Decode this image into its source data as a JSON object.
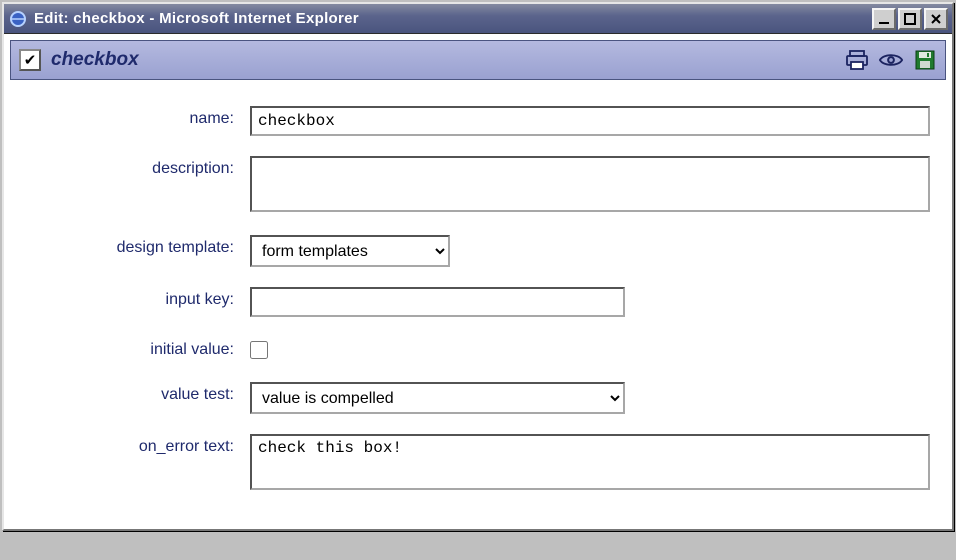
{
  "window": {
    "title": "Edit: checkbox - Microsoft Internet Explorer"
  },
  "header": {
    "heading": "checkbox"
  },
  "form": {
    "name": {
      "label": "name:",
      "value": "checkbox"
    },
    "description": {
      "label": "description:",
      "value": ""
    },
    "design": {
      "label": "design template:",
      "value": "form templates"
    },
    "inputkey": {
      "label": "input key:",
      "value": ""
    },
    "initial": {
      "label": "initial value:",
      "checked": false
    },
    "valuetest": {
      "label": "value test:",
      "value": "value is compelled"
    },
    "onerror": {
      "label": "on_error text:",
      "value": "check this box!"
    }
  }
}
